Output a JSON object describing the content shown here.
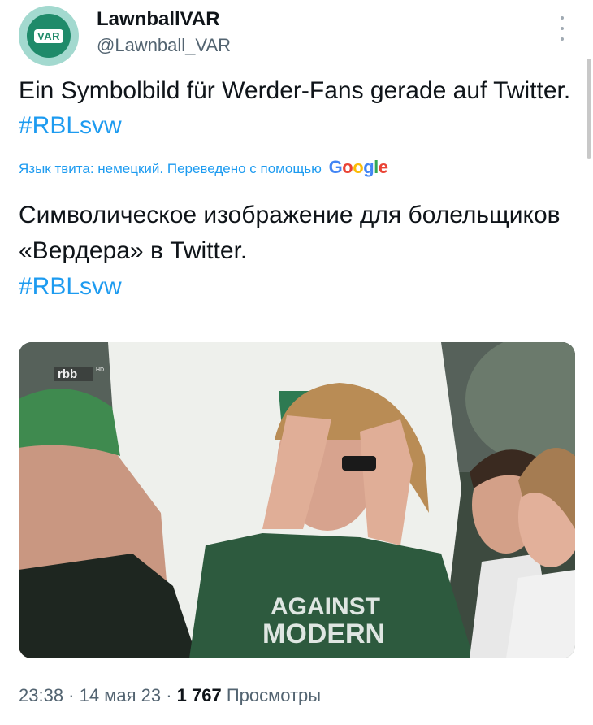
{
  "author": {
    "name": "LawnballVAR",
    "handle": "@Lawnball_VAR",
    "avatar_text": "VAR"
  },
  "tweet": {
    "text": "Ein Symbolbild für Werder-Fans gerade auf Twitter.",
    "hashtag": "#RBLsvw"
  },
  "translation": {
    "notice": "Язык твита: немецкий. Переведено с помощью",
    "provider": [
      "G",
      "o",
      "o",
      "g",
      "l",
      "e"
    ],
    "text": "Символическое изображение для болельщиков «Вердера» в Twitter.",
    "hashtag": "#RBLsvw"
  },
  "media": {
    "broadcaster_logo": "rbb",
    "broadcaster_sub": "HD",
    "shirt_text_1": "AGAINST",
    "shirt_text_2": "MODERN"
  },
  "meta": {
    "time": "23:38",
    "sep1": " · ",
    "date": "14 мая 23",
    "sep2": " · ",
    "views": "1 767",
    "views_label": " Просмотры"
  },
  "icons": {
    "more": "more-vertical-icon"
  }
}
